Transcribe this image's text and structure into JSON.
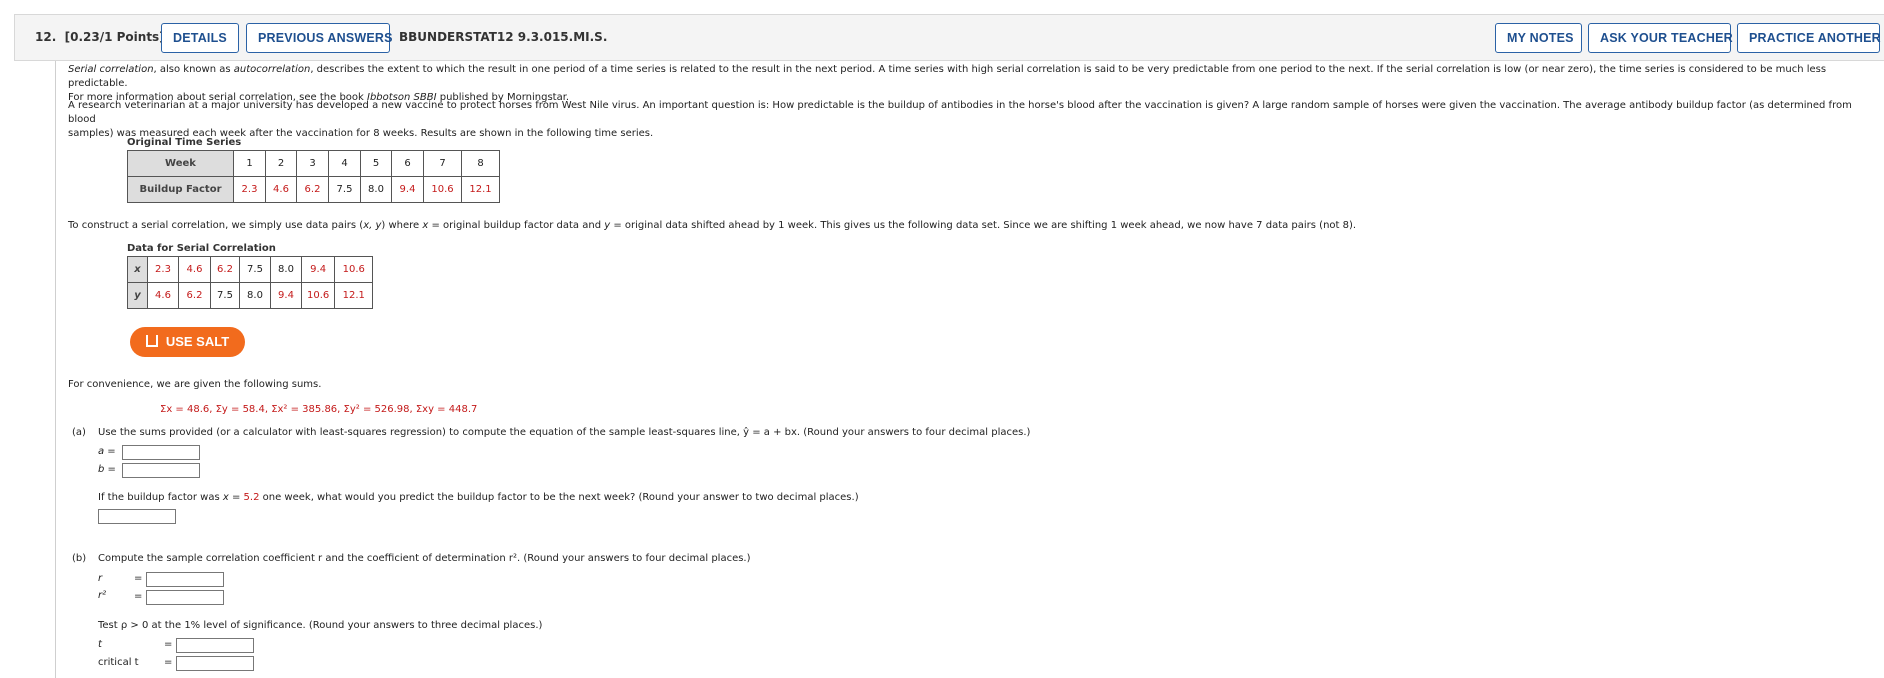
{
  "header": {
    "question_number": "12.",
    "points": "[0.23/1 Points]",
    "details_button": "DETAILS",
    "previous_answers_button": "PREVIOUS ANSWERS",
    "problem_code": "BBUNDERSTAT12 9.3.015.MI.S.",
    "my_notes_button": "MY NOTES",
    "ask_teacher_button": "ASK YOUR TEACHER",
    "practice_button": "PRACTICE ANOTHER"
  },
  "intro": {
    "term1": "Serial correlation",
    "text1": ", also known as ",
    "term2": "autocorrelation",
    "text2": ", describes the extent to which the result in one period of a time series is related to the result in the next period. A time series with high serial correlation is said to be very predictable from one period to the next. If the serial correlation is low (or near zero), the time series is considered to be much less predictable.",
    "text3": "For more information about serial correlation, see the book ",
    "book": "Ibbotson SBBI",
    "text4": " published by Morningstar."
  },
  "scenario": {
    "line1": "A research veterinarian at a major university has developed a new vaccine to protect horses from West Nile virus. An important question is: How predictable is the buildup of antibodies in the horse's blood after the vaccination is given? A large random sample of horses were given the vaccination. The average antibody buildup factor (as determined from blood",
    "line2": "samples) was measured each week after the vaccination for 8 weeks. Results are shown in the following time series."
  },
  "original_table": {
    "caption": "Original Time Series",
    "row1_header": "Week",
    "weeks": [
      "1",
      "2",
      "3",
      "4",
      "5",
      "6",
      "7",
      "8"
    ],
    "row2_header": "Buildup Factor",
    "factors": [
      "2.3",
      "4.6",
      "6.2",
      "7.5",
      "8.0",
      "9.4",
      "10.6",
      "12.1"
    ]
  },
  "construct_text": {
    "a": "To construct a serial correlation, we simply use data pairs (",
    "xy": "x, y",
    "b": ") where ",
    "x": "x",
    "c": " = original buildup factor data and ",
    "y": "y",
    "d": " = original data shifted ahead by 1 week. This gives us the following data set. Since we are shifting 1 week ahead, we now have 7 data pairs (not 8)."
  },
  "serial_table": {
    "caption": "Data for Serial Correlation",
    "x_label": "x",
    "x_values": [
      "2.3",
      "4.6",
      "6.2",
      "7.5",
      "8.0",
      "9.4",
      "10.6"
    ],
    "y_label": "y",
    "y_values": [
      "4.6",
      "6.2",
      "7.5",
      "8.0",
      "9.4",
      "10.6",
      "12.1"
    ]
  },
  "salt_button": "USE SALT",
  "convenience": "For convenience, we are given the following sums.",
  "sums": "Σx = 48.6, Σy = 58.4, Σx² = 385.86, Σy² = 526.98, Σxy = 448.7",
  "part_a": {
    "label": "(a)",
    "prompt": "Use the sums provided (or a calculator with least-squares regression) to compute the equation of the sample least-squares line, ŷ = a + bx. (Round your answers to four decimal places.)",
    "a_label": "a  =",
    "b_label": "b  =",
    "predict_a": "If the buildup factor was ",
    "predict_x": "x",
    "predict_eq": " = ",
    "predict_val": "5.2",
    "predict_b": " one week, what would you predict the buildup factor to be the next week? (Round your answer to two decimal places.)",
    "a_value": "",
    "b_value": "",
    "prediction_value": ""
  },
  "part_b": {
    "label": "(b)",
    "prompt": "Compute the sample correlation coefficient r and the coefficient of determination r². (Round your answers to four decimal places.)",
    "r_label": "r",
    "r2_label": "r²",
    "eq": "=",
    "test_prompt": "Test ρ > 0 at the 1% level of significance. (Round your answers to three decimal places.)",
    "t_label": "t",
    "critical_t_label": "critical t",
    "r_value": "",
    "r2_value": "",
    "t_value": "",
    "critical_t_value": ""
  }
}
